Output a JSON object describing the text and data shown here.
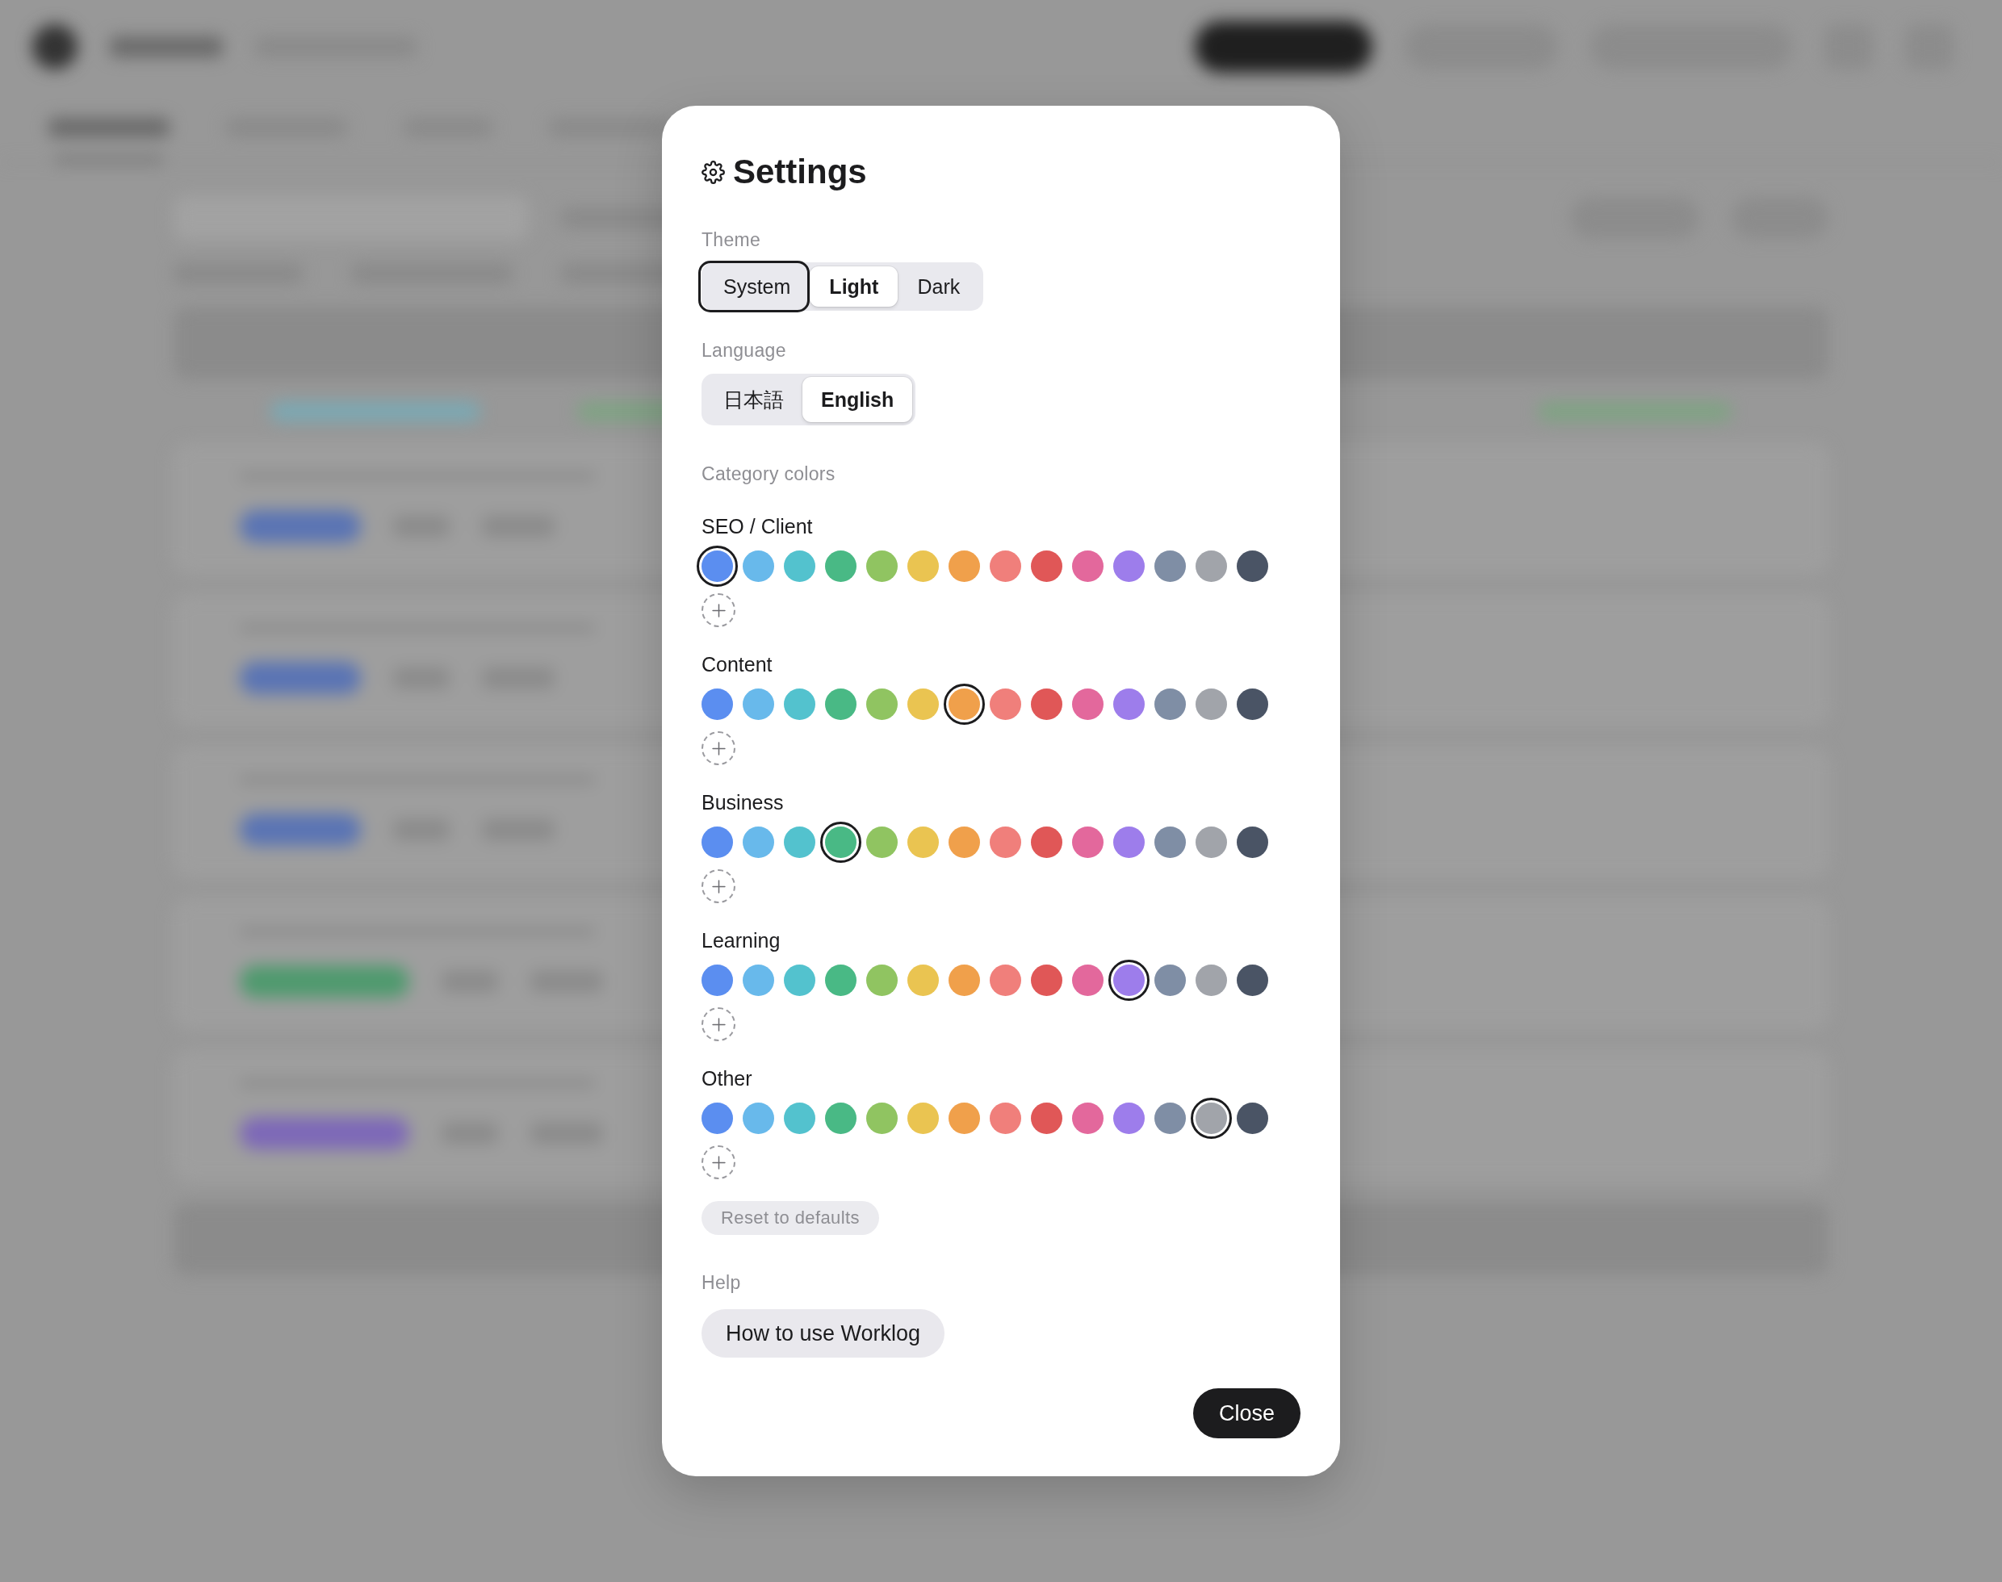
{
  "dialog": {
    "title": "Settings"
  },
  "theme": {
    "label": "Theme",
    "options": [
      {
        "label": "System",
        "selected": false,
        "focused": true
      },
      {
        "label": "Light",
        "selected": true,
        "focused": false
      },
      {
        "label": "Dark",
        "selected": false,
        "focused": false
      }
    ]
  },
  "language": {
    "label": "Language",
    "options": [
      {
        "label": "日本語",
        "selected": false
      },
      {
        "label": "English",
        "selected": true
      }
    ]
  },
  "category_colors": {
    "label": "Category colors",
    "categories": [
      {
        "name": "SEO / Client",
        "swatches": [
          {
            "color": "#5b8ef0",
            "selected": true
          },
          {
            "color": "#68b9eb",
            "selected": false
          },
          {
            "color": "#53c2ce",
            "selected": false
          },
          {
            "color": "#49b985",
            "selected": false
          },
          {
            "color": "#90c461",
            "selected": false
          },
          {
            "color": "#eac451",
            "selected": false
          },
          {
            "color": "#f0a04b",
            "selected": false
          },
          {
            "color": "#f07f7b",
            "selected": false
          },
          {
            "color": "#e05757",
            "selected": false
          },
          {
            "color": "#e3689c",
            "selected": false
          },
          {
            "color": "#9d7deb",
            "selected": false
          },
          {
            "color": "#7f8ea5",
            "selected": false
          },
          {
            "color": "#a1a4aa",
            "selected": false
          },
          {
            "color": "#4a5465",
            "selected": false
          }
        ]
      },
      {
        "name": "Content",
        "swatches": [
          {
            "color": "#5b8ef0",
            "selected": false
          },
          {
            "color": "#68b9eb",
            "selected": false
          },
          {
            "color": "#53c2ce",
            "selected": false
          },
          {
            "color": "#49b985",
            "selected": false
          },
          {
            "color": "#90c461",
            "selected": false
          },
          {
            "color": "#eac451",
            "selected": false
          },
          {
            "color": "#f0a04b",
            "selected": true
          },
          {
            "color": "#f07f7b",
            "selected": false
          },
          {
            "color": "#e05757",
            "selected": false
          },
          {
            "color": "#e3689c",
            "selected": false
          },
          {
            "color": "#9d7deb",
            "selected": false
          },
          {
            "color": "#7f8ea5",
            "selected": false
          },
          {
            "color": "#a1a4aa",
            "selected": false
          },
          {
            "color": "#4a5465",
            "selected": false
          }
        ]
      },
      {
        "name": "Business",
        "swatches": [
          {
            "color": "#5b8ef0",
            "selected": false
          },
          {
            "color": "#68b9eb",
            "selected": false
          },
          {
            "color": "#53c2ce",
            "selected": false
          },
          {
            "color": "#49b985",
            "selected": true
          },
          {
            "color": "#90c461",
            "selected": false
          },
          {
            "color": "#eac451",
            "selected": false
          },
          {
            "color": "#f0a04b",
            "selected": false
          },
          {
            "color": "#f07f7b",
            "selected": false
          },
          {
            "color": "#e05757",
            "selected": false
          },
          {
            "color": "#e3689c",
            "selected": false
          },
          {
            "color": "#9d7deb",
            "selected": false
          },
          {
            "color": "#7f8ea5",
            "selected": false
          },
          {
            "color": "#a1a4aa",
            "selected": false
          },
          {
            "color": "#4a5465",
            "selected": false
          }
        ]
      },
      {
        "name": "Learning",
        "swatches": [
          {
            "color": "#5b8ef0",
            "selected": false
          },
          {
            "color": "#68b9eb",
            "selected": false
          },
          {
            "color": "#53c2ce",
            "selected": false
          },
          {
            "color": "#49b985",
            "selected": false
          },
          {
            "color": "#90c461",
            "selected": false
          },
          {
            "color": "#eac451",
            "selected": false
          },
          {
            "color": "#f0a04b",
            "selected": false
          },
          {
            "color": "#f07f7b",
            "selected": false
          },
          {
            "color": "#e05757",
            "selected": false
          },
          {
            "color": "#e3689c",
            "selected": false
          },
          {
            "color": "#9d7deb",
            "selected": true
          },
          {
            "color": "#7f8ea5",
            "selected": false
          },
          {
            "color": "#a1a4aa",
            "selected": false
          },
          {
            "color": "#4a5465",
            "selected": false
          }
        ]
      },
      {
        "name": "Other",
        "swatches": [
          {
            "color": "#5b8ef0",
            "selected": false
          },
          {
            "color": "#68b9eb",
            "selected": false
          },
          {
            "color": "#53c2ce",
            "selected": false
          },
          {
            "color": "#49b985",
            "selected": false
          },
          {
            "color": "#90c461",
            "selected": false
          },
          {
            "color": "#eac451",
            "selected": false
          },
          {
            "color": "#f0a04b",
            "selected": false
          },
          {
            "color": "#f07f7b",
            "selected": false
          },
          {
            "color": "#e05757",
            "selected": false
          },
          {
            "color": "#e3689c",
            "selected": false
          },
          {
            "color": "#9d7deb",
            "selected": false
          },
          {
            "color": "#7f8ea5",
            "selected": false
          },
          {
            "color": "#a1a4aa",
            "selected": true
          },
          {
            "color": "#4a5465",
            "selected": false
          }
        ]
      }
    ],
    "reset_button": "Reset to defaults"
  },
  "help": {
    "label": "Help",
    "button": "How to use Worklog"
  },
  "close_button": "Close"
}
